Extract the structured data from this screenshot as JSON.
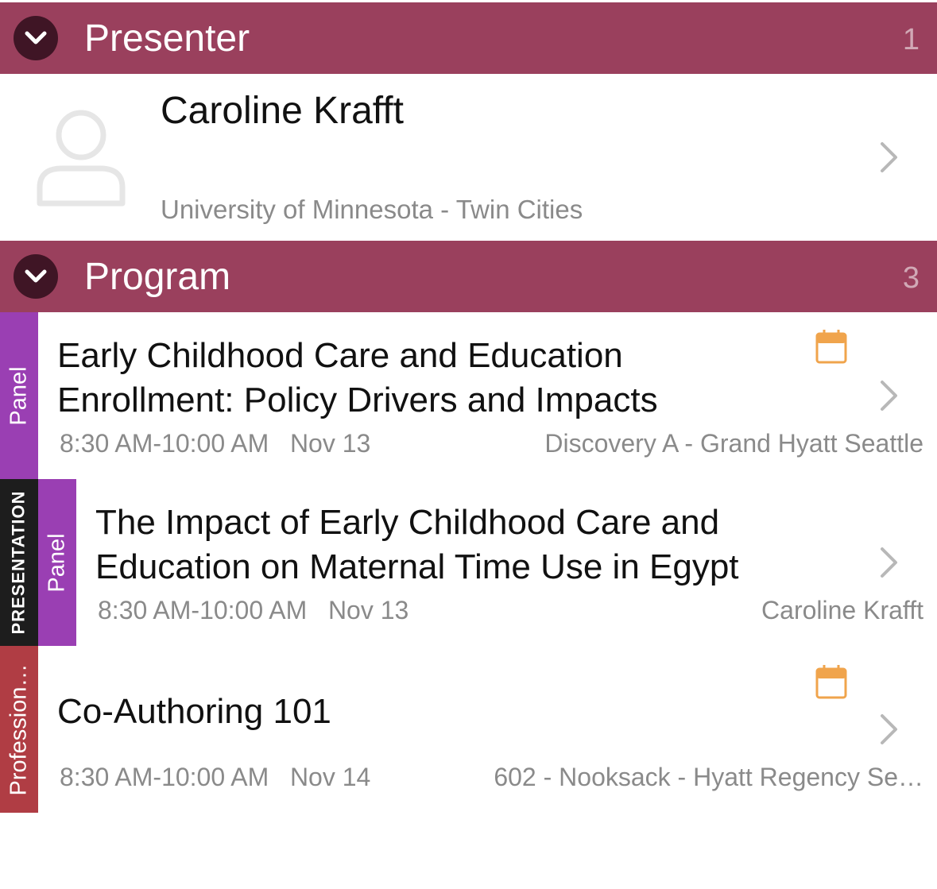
{
  "presenter_section": {
    "title": "Presenter",
    "count": "1",
    "person": {
      "name": "Caroline Krafft",
      "organization": "University of Minnesota - Twin Cities"
    }
  },
  "program_section": {
    "title": "Program",
    "count": "3",
    "items": [
      {
        "tag": "Panel",
        "title_line1": "Early Childhood Care and Education",
        "title_line2": "Enrollment: Policy Drivers and Impacts",
        "time": "8:30 AM-10:00 AM",
        "date": "Nov 13",
        "location": "Discovery A - Grand Hyatt Seattle",
        "has_calendar": true
      },
      {
        "outer_tag": "PRESENTATION",
        "tag": "Panel",
        "title_line1": "The Impact of Early Childhood Care and",
        "title_line2": "Education on Maternal Time Use in Egypt",
        "time": "8:30 AM-10:00 AM",
        "date": "Nov 13",
        "location": "Caroline Krafft",
        "has_calendar": false
      },
      {
        "tag": "Profession…",
        "title_line1": "Co-Authoring 101",
        "time": "8:30 AM-10:00 AM",
        "date": "Nov 14",
        "location": "602 - Nooksack - Hyatt Regency Se…",
        "has_calendar": true
      }
    ]
  },
  "colors": {
    "header_bg": "#9a405d",
    "toggle_bg": "#3f1525",
    "panel_tag": "#9a3fb3",
    "presentation_tag": "#1d1d1d",
    "professional_tag": "#b03d44",
    "calendar_icon": "#f0a44c"
  }
}
